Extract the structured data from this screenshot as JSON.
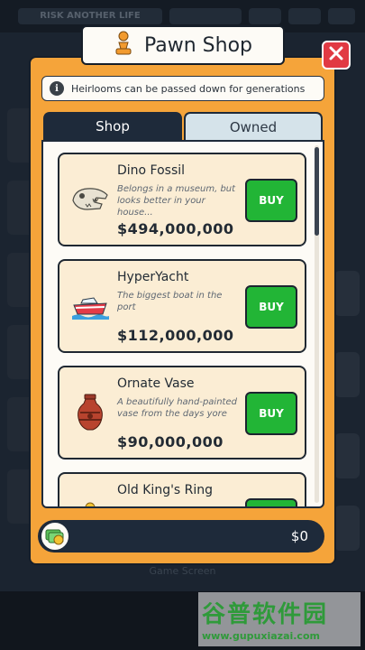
{
  "background": {
    "title": "RISK ANOTHER LIFE",
    "bottom_text": "Game Screen"
  },
  "modal": {
    "title": "Pawn Shop",
    "info": "Heirlooms can be passed down for generations",
    "tabs": [
      {
        "label": "Shop",
        "selected": true
      },
      {
        "label": "Owned",
        "selected": false
      }
    ],
    "items": [
      {
        "name": "Dino Fossil",
        "description": "Belongs in a museum, but looks better in your house...",
        "price": "$494,000,000",
        "buy_label": "BUY",
        "icon": "dinosaur-skull-icon"
      },
      {
        "name": "HyperYacht",
        "description": "The biggest boat in the port",
        "price": "$112,000,000",
        "buy_label": "BUY",
        "icon": "yacht-icon"
      },
      {
        "name": "Ornate Vase",
        "description": "A beautifully hand-painted vase from the days yore",
        "price": "$90,000,000",
        "buy_label": "BUY",
        "icon": "vase-icon"
      },
      {
        "name": "Old King's Ring",
        "description": "",
        "price": "",
        "buy_label": "",
        "icon": "ring-icon"
      }
    ],
    "balance": "$0"
  },
  "watermark": {
    "text": "谷普软件园",
    "url": "www.gupuxiazai.com"
  },
  "colors": {
    "frame": "#f5a43a",
    "buy_button": "#22b536",
    "close_button": "#e13a43",
    "dark": "#1e2a3a"
  }
}
